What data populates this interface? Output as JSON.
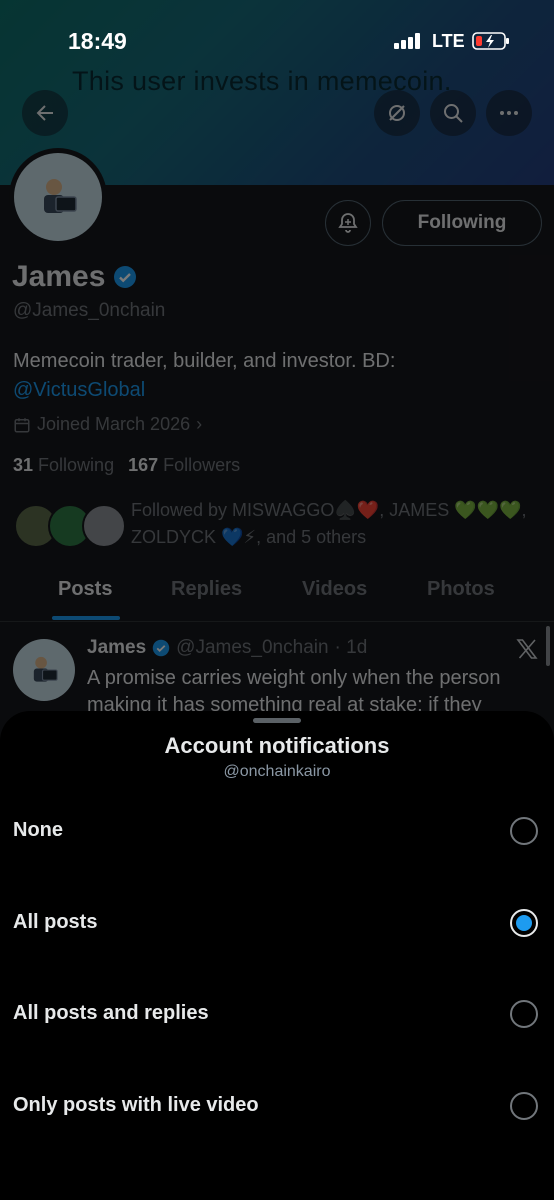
{
  "status_bar": {
    "time": "18:49",
    "network": "LTE"
  },
  "banner": {
    "text": "This user invests in memecoin."
  },
  "profile": {
    "name": "James",
    "handle": "@James_0nchain",
    "bio_text": "Memecoin trader, builder, and investor. BD: ",
    "bio_link": "@VictusGlobal",
    "joined": "Joined March 2026",
    "following_count": "31",
    "following_label": "Following",
    "followers_count": "167",
    "followers_label": "Followers",
    "followed_by": "Followed by MISWAGGO♠️❤️, JAMES 💚💚💚, ZOLDYCK 💙⚡, and 5 others",
    "follow_button": "Following"
  },
  "tabs": [
    "Posts",
    "Replies",
    "Videos",
    "Photos"
  ],
  "post": {
    "name": "James",
    "handle": "@James_0nchain",
    "age": "· 1d",
    "text": "A promise carries weight only when the person making it has something real at stake: if they"
  },
  "sheet": {
    "title": "Account notifications",
    "subtitle": "@onchainkairo",
    "options": [
      {
        "label": "None",
        "selected": false
      },
      {
        "label": "All posts",
        "selected": true
      },
      {
        "label": "All posts and replies",
        "selected": false
      },
      {
        "label": "Only posts with live video",
        "selected": false
      }
    ]
  },
  "colors": {
    "accent": "#1d9bf0",
    "background": "#000000",
    "secondary_text": "#71767b"
  },
  "icons": [
    "back-arrow-icon",
    "notification-off-icon",
    "search-icon",
    "more-icon",
    "bell-icon",
    "verified-icon",
    "calendar-icon",
    "x-logo-icon"
  ]
}
